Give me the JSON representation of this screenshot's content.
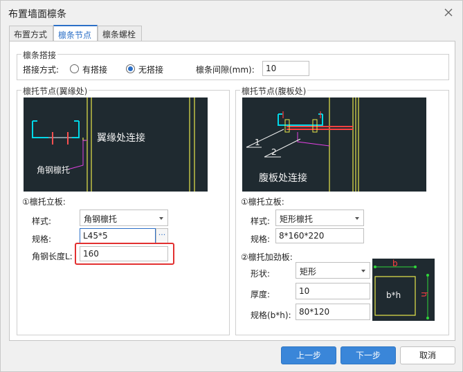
{
  "window": {
    "title": "布置墙面檩条"
  },
  "tabs": [
    {
      "label": "布置方式"
    },
    {
      "label": "檩条节点"
    },
    {
      "label": "檩条螺栓"
    }
  ],
  "purlin_lap": {
    "group_title": "檩条搭接",
    "lap_mode_label": "搭接方式:",
    "option_lap": "有搭接",
    "option_nolap": "无搭接",
    "selected": "无搭接",
    "gap_label": "檩条间隙(mm):",
    "gap_value": "10"
  },
  "left_node": {
    "group_title": "檩托节点(翼缘处)",
    "diagram_text_main": "翼缘处连接",
    "diagram_text_sub": "角钢檩托",
    "plate_title": "①檩托立板:",
    "style_label": "样式:",
    "style_value": "角钢檩托",
    "spec_label": "规格:",
    "spec_value": "L45*5",
    "length_label": "角钢长度L:",
    "length_value": "160"
  },
  "right_node": {
    "group_title": "檩托节点(腹板处)",
    "diagram_text_main": "腹板处连接",
    "diagram_num_1": "1",
    "diagram_num_2": "2",
    "plate_title": "①檩托立板:",
    "style_label": "样式:",
    "style_value": "矩形檩托",
    "spec_label": "规格:",
    "spec_value": "8*160*220",
    "stiffener_title": "②檩托加劲板:",
    "shape_label": "形状:",
    "shape_value": "矩形",
    "thickness_label": "厚度:",
    "thickness_value": "10",
    "size_label": "规格(b*h):",
    "size_value": "80*120",
    "preview_b": "b",
    "preview_h": "h",
    "preview_bh": "b*h"
  },
  "footer": {
    "prev": "上一步",
    "next": "下一步",
    "cancel": "取消"
  },
  "colors": {
    "accent": "#2b6fc7",
    "cad_bg": "#1f2a30",
    "highlight": "#e23030"
  }
}
